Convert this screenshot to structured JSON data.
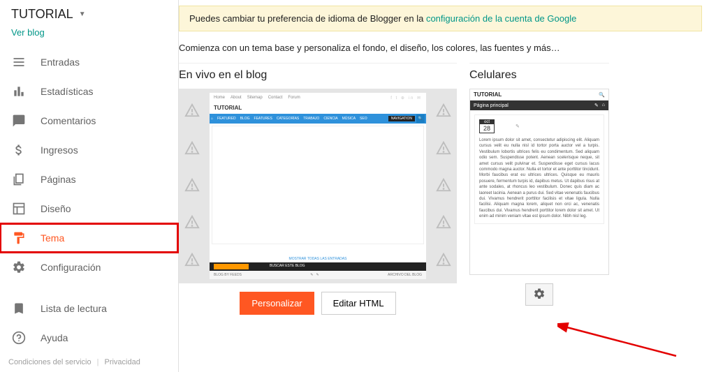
{
  "blog_selector": {
    "name": "TUTORIAL"
  },
  "view_blog_label": "Ver blog",
  "sidebar": {
    "items": [
      {
        "label": "Entradas",
        "icon": "posts"
      },
      {
        "label": "Estadísticas",
        "icon": "stats"
      },
      {
        "label": "Comentarios",
        "icon": "comments"
      },
      {
        "label": "Ingresos",
        "icon": "earnings"
      },
      {
        "label": "Páginas",
        "icon": "pages"
      },
      {
        "label": "Diseño",
        "icon": "layout"
      },
      {
        "label": "Tema",
        "icon": "theme"
      },
      {
        "label": "Configuración",
        "icon": "settings"
      }
    ],
    "footer_items": [
      {
        "label": "Lista de lectura",
        "icon": "reading"
      },
      {
        "label": "Ayuda",
        "icon": "help"
      }
    ],
    "legal": {
      "terms": "Condiciones del servicio",
      "privacy": "Privacidad"
    }
  },
  "notice": {
    "text": "Puedes cambiar tu preferencia de idioma de Blogger en la ",
    "link": "configuración de la cuenta de Google"
  },
  "intro": "Comienza con un tema base y personaliza el fondo, el diseño, los colores, las fuentes y más…",
  "panels": {
    "live": {
      "title": "En vivo en el blog",
      "buttons": {
        "customize": "Personalizar",
        "edit_html": "Editar HTML"
      },
      "preview": {
        "nav": [
          "Home",
          "About",
          "Sitemap",
          "Contact",
          "Forum"
        ],
        "title": "TUTORIAL",
        "menu": [
          "FEATURED",
          "BLOG",
          "FEATURES",
          "CATEGORÍAS",
          "TRABAJO",
          "CIENCIA",
          "MÚSICA",
          "SEO"
        ],
        "menu_btn": "NAVIGATION",
        "widget_link": "MOSTRAR TODAS LAS ENTRADAS",
        "footer_left": "BLOG BY FEEDS",
        "footer_right": "BUSCAR ESTE BLOG",
        "archive": "ARCHIVO DEL BLOG"
      }
    },
    "mobile": {
      "title": "Celulares",
      "preview": {
        "title": "TUTORIAL",
        "bar": "Página principal",
        "date_month": "oct",
        "date_day": "28",
        "lorem": "Lorem ipsum dolor sit amet, consectetur adipiscing elit. Aliquam cursus velit eu nulla nisl id tortor porta auctor vel a turpis. Vestibulum lobortis ultrices felis eu condimentum. Sed aliquam odio sem. Suspendisse potent. Aenean scelerisque neque, sit amet cursus velit pulvinar et. Suspendisse eget cursus lacus commodo magna auctor. Nulla et tortor et ante porttitor tincidunt. Morbi faucibus erat eu ultrices ultrices. Quisque eu mauris posuere, fermentum turpis id, dapibus metus. Ut dapibus risus at ante sodales, at rhoncus leo vestibulum. Donec quis diam ac laoreet lacinia. Aenean a purus dui. Sed vitae venenatis faucibus dui. Vivamus hendrerit porttitor facilisis et vitae ligula. Nulla facilisi. Aliquam magna lorem, aliquet non orci ac, venenatis faucibus dui. Vivamus hendrerit porttitor lorem dolor sit amet. Ut enim ad minim veniam vitae est ipsum dolor. Nibh nisl leg."
      }
    }
  }
}
